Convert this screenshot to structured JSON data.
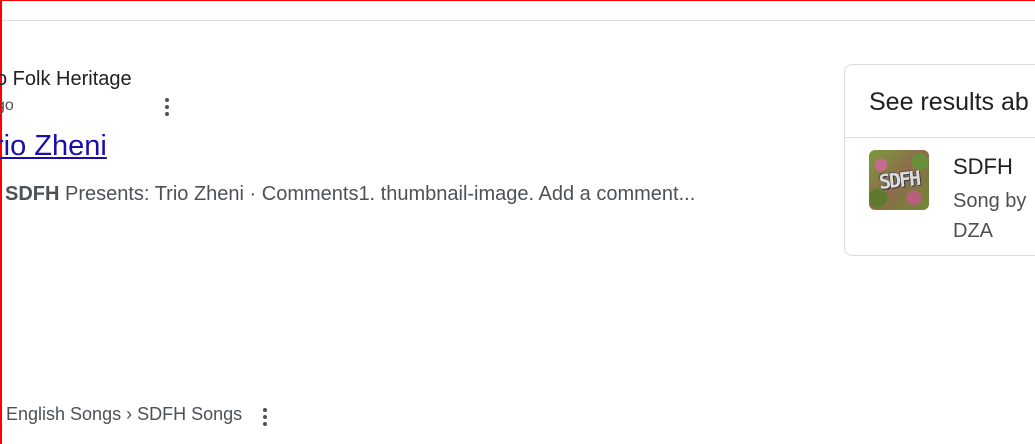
{
  "result": {
    "site_name": "o Folk Heritage",
    "time_ago": "go",
    "title": "rio Zheni",
    "snippet_bold": "SDFH",
    "snippet_rest": " Presents: Trio Zheni · Comments1. thumbnail-image. Add a comment..."
  },
  "next_result": {
    "breadcrumb": "English Songs › SDFH Songs"
  },
  "panel": {
    "heading": "See results ab",
    "song_title": "SDFH",
    "song_subtitle": "Song by DZA",
    "thumb_text": "SDFH"
  },
  "colors": {
    "link": "#1a0dab",
    "text": "#202124",
    "muted": "#4d5156",
    "border": "#dadce0",
    "frame": "#ff0000"
  }
}
